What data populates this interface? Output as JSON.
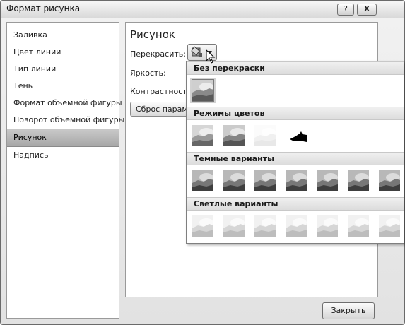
{
  "window": {
    "title": "Формат рисунка",
    "help_label": "?",
    "close_label": "X"
  },
  "sidebar": {
    "items": [
      {
        "label": "Заливка"
      },
      {
        "label": "Цвет линии"
      },
      {
        "label": "Тип линии"
      },
      {
        "label": "Тень"
      },
      {
        "label": "Формат объемной фигуры"
      },
      {
        "label": "Поворот объемной фигуры"
      },
      {
        "label": "Рисунок",
        "selected": true
      },
      {
        "label": "Надпись"
      }
    ]
  },
  "main": {
    "section_title": "Рисунок",
    "recolor_label": "Перекрасить:",
    "brightness_label": "Яркость:",
    "contrast_label": "Контрастность:",
    "reset_label": "Сброс параметров рисунка"
  },
  "recolor_menu": {
    "no_recolor_header": "Без перекраски",
    "color_modes_header": "Режимы цветов",
    "dark_variants_header": "Темные варианты",
    "light_variants_header": "Светлые варианты",
    "color_modes": [
      "grayscale",
      "sepia",
      "washout",
      "black-and-white"
    ],
    "dark_variants_count": 7,
    "light_variants_count": 7
  },
  "footer": {
    "close_label": "Закрыть"
  },
  "colors": {
    "sidebar_selected": "#b5b5b5",
    "header_bg": "#e4e4e4"
  }
}
